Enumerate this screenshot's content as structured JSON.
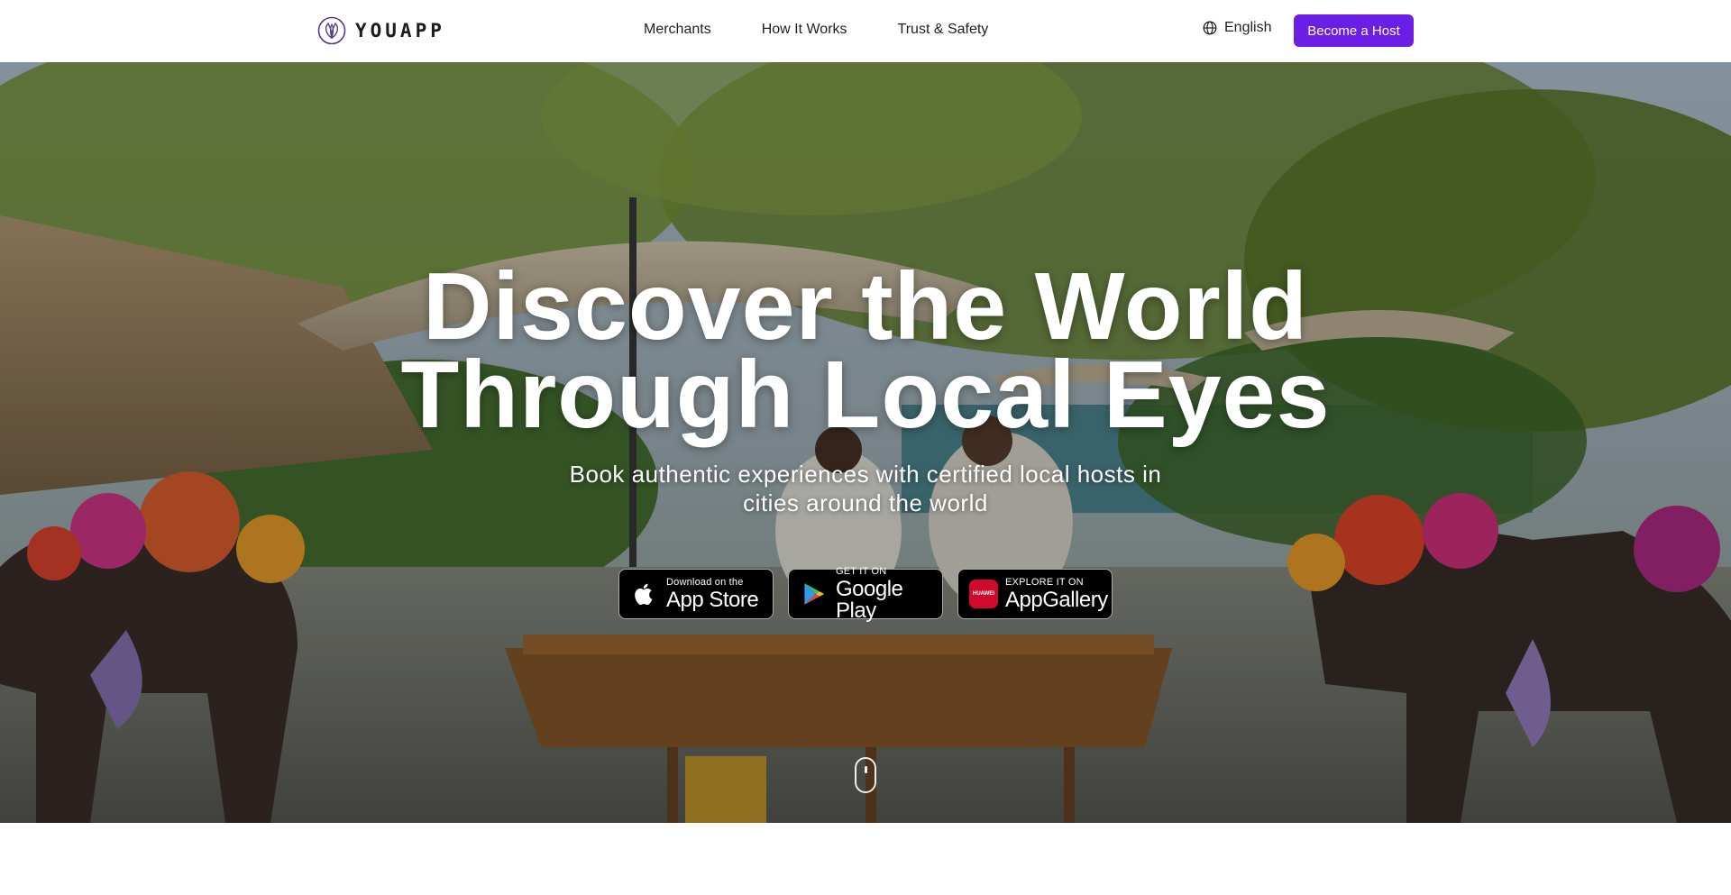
{
  "brand": {
    "name": "YOUAPP",
    "accent": "#6a1ee6"
  },
  "nav": {
    "links": [
      "Merchants",
      "How It Works",
      "Trust & Safety"
    ],
    "language": "English",
    "cta": "Become a Host"
  },
  "hero": {
    "title_line1": "Discover the World",
    "title_line2": "Through Local Eyes",
    "subtitle": "Book authentic experiences with certified local hosts in cities around the world",
    "stores": {
      "apple": {
        "small": "Download on the",
        "big": "App Store",
        "icon": "apple-icon"
      },
      "google": {
        "small": "GET IT ON",
        "big": "Google Play",
        "icon": "google-play-icon"
      },
      "huawei": {
        "small": "EXPLORE IT ON",
        "big": "AppGallery",
        "icon": "huawei-icon",
        "badge": "HUAWEI"
      }
    },
    "scroll_icon": "mouse-scroll-icon"
  }
}
